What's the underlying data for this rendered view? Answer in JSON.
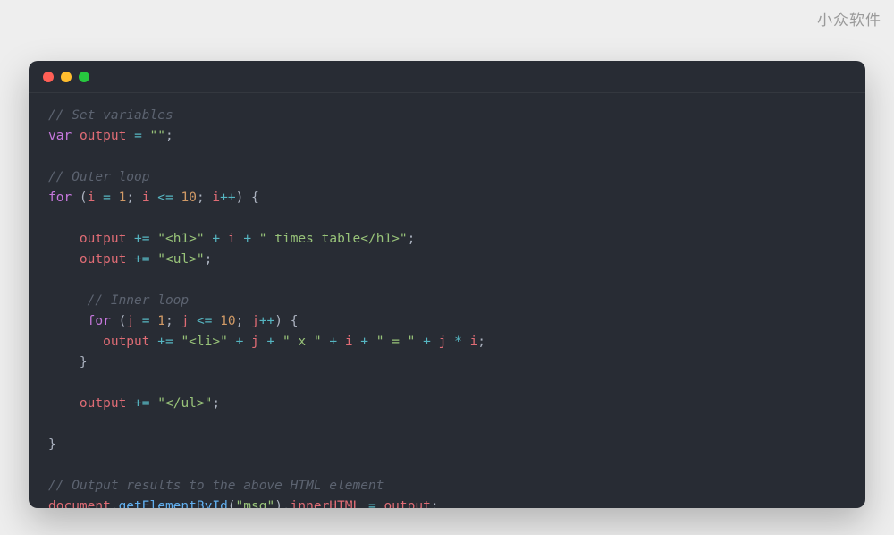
{
  "watermark": "小众软件",
  "code_tokens": [
    [
      {
        "c": "c-cm",
        "t": "// Set variables"
      }
    ],
    [
      {
        "c": "c-kw",
        "t": "var"
      },
      {
        "c": "c-pl",
        "t": " "
      },
      {
        "c": "c-id",
        "t": "output"
      },
      {
        "c": "c-pl",
        "t": " "
      },
      {
        "c": "c-op",
        "t": "="
      },
      {
        "c": "c-pl",
        "t": " "
      },
      {
        "c": "c-st",
        "t": "\"\""
      },
      {
        "c": "c-pl",
        "t": ";"
      }
    ],
    [],
    [
      {
        "c": "c-cm",
        "t": "// Outer loop"
      }
    ],
    [
      {
        "c": "c-kw",
        "t": "for"
      },
      {
        "c": "c-pl",
        "t": " ("
      },
      {
        "c": "c-id",
        "t": "i"
      },
      {
        "c": "c-pl",
        "t": " "
      },
      {
        "c": "c-op",
        "t": "="
      },
      {
        "c": "c-pl",
        "t": " "
      },
      {
        "c": "c-nm",
        "t": "1"
      },
      {
        "c": "c-pl",
        "t": "; "
      },
      {
        "c": "c-id",
        "t": "i"
      },
      {
        "c": "c-pl",
        "t": " "
      },
      {
        "c": "c-op",
        "t": "<="
      },
      {
        "c": "c-pl",
        "t": " "
      },
      {
        "c": "c-nm",
        "t": "10"
      },
      {
        "c": "c-pl",
        "t": "; "
      },
      {
        "c": "c-id",
        "t": "i"
      },
      {
        "c": "c-op",
        "t": "++"
      },
      {
        "c": "c-pl",
        "t": ") {"
      }
    ],
    [],
    [
      {
        "c": "c-pl",
        "t": "    "
      },
      {
        "c": "c-id",
        "t": "output"
      },
      {
        "c": "c-pl",
        "t": " "
      },
      {
        "c": "c-op",
        "t": "+="
      },
      {
        "c": "c-pl",
        "t": " "
      },
      {
        "c": "c-st",
        "t": "\"<h1>\""
      },
      {
        "c": "c-pl",
        "t": " "
      },
      {
        "c": "c-op",
        "t": "+"
      },
      {
        "c": "c-pl",
        "t": " "
      },
      {
        "c": "c-id",
        "t": "i"
      },
      {
        "c": "c-pl",
        "t": " "
      },
      {
        "c": "c-op",
        "t": "+"
      },
      {
        "c": "c-pl",
        "t": " "
      },
      {
        "c": "c-st",
        "t": "\" times table</h1>\""
      },
      {
        "c": "c-pl",
        "t": ";"
      }
    ],
    [
      {
        "c": "c-pl",
        "t": "    "
      },
      {
        "c": "c-id",
        "t": "output"
      },
      {
        "c": "c-pl",
        "t": " "
      },
      {
        "c": "c-op",
        "t": "+="
      },
      {
        "c": "c-pl",
        "t": " "
      },
      {
        "c": "c-st",
        "t": "\"<ul>\""
      },
      {
        "c": "c-pl",
        "t": ";"
      }
    ],
    [],
    [
      {
        "c": "c-pl",
        "t": "     "
      },
      {
        "c": "c-cm",
        "t": "// Inner loop"
      }
    ],
    [
      {
        "c": "c-pl",
        "t": "     "
      },
      {
        "c": "c-kw",
        "t": "for"
      },
      {
        "c": "c-pl",
        "t": " ("
      },
      {
        "c": "c-id",
        "t": "j"
      },
      {
        "c": "c-pl",
        "t": " "
      },
      {
        "c": "c-op",
        "t": "="
      },
      {
        "c": "c-pl",
        "t": " "
      },
      {
        "c": "c-nm",
        "t": "1"
      },
      {
        "c": "c-pl",
        "t": "; "
      },
      {
        "c": "c-id",
        "t": "j"
      },
      {
        "c": "c-pl",
        "t": " "
      },
      {
        "c": "c-op",
        "t": "<="
      },
      {
        "c": "c-pl",
        "t": " "
      },
      {
        "c": "c-nm",
        "t": "10"
      },
      {
        "c": "c-pl",
        "t": "; "
      },
      {
        "c": "c-id",
        "t": "j"
      },
      {
        "c": "c-op",
        "t": "++"
      },
      {
        "c": "c-pl",
        "t": ") {"
      }
    ],
    [
      {
        "c": "c-pl",
        "t": "       "
      },
      {
        "c": "c-id",
        "t": "output"
      },
      {
        "c": "c-pl",
        "t": " "
      },
      {
        "c": "c-op",
        "t": "+="
      },
      {
        "c": "c-pl",
        "t": " "
      },
      {
        "c": "c-st",
        "t": "\"<li>\""
      },
      {
        "c": "c-pl",
        "t": " "
      },
      {
        "c": "c-op",
        "t": "+"
      },
      {
        "c": "c-pl",
        "t": " "
      },
      {
        "c": "c-id",
        "t": "j"
      },
      {
        "c": "c-pl",
        "t": " "
      },
      {
        "c": "c-op",
        "t": "+"
      },
      {
        "c": "c-pl",
        "t": " "
      },
      {
        "c": "c-st",
        "t": "\" x \""
      },
      {
        "c": "c-pl",
        "t": " "
      },
      {
        "c": "c-op",
        "t": "+"
      },
      {
        "c": "c-pl",
        "t": " "
      },
      {
        "c": "c-id",
        "t": "i"
      },
      {
        "c": "c-pl",
        "t": " "
      },
      {
        "c": "c-op",
        "t": "+"
      },
      {
        "c": "c-pl",
        "t": " "
      },
      {
        "c": "c-st",
        "t": "\" = \""
      },
      {
        "c": "c-pl",
        "t": " "
      },
      {
        "c": "c-op",
        "t": "+"
      },
      {
        "c": "c-pl",
        "t": " "
      },
      {
        "c": "c-id",
        "t": "j"
      },
      {
        "c": "c-pl",
        "t": " "
      },
      {
        "c": "c-op",
        "t": "*"
      },
      {
        "c": "c-pl",
        "t": " "
      },
      {
        "c": "c-id",
        "t": "i"
      },
      {
        "c": "c-pl",
        "t": ";"
      }
    ],
    [
      {
        "c": "c-pl",
        "t": "    }"
      }
    ],
    [],
    [
      {
        "c": "c-pl",
        "t": "    "
      },
      {
        "c": "c-id",
        "t": "output"
      },
      {
        "c": "c-pl",
        "t": " "
      },
      {
        "c": "c-op",
        "t": "+="
      },
      {
        "c": "c-pl",
        "t": " "
      },
      {
        "c": "c-st",
        "t": "\"</ul>\""
      },
      {
        "c": "c-pl",
        "t": ";"
      }
    ],
    [],
    [
      {
        "c": "c-pl",
        "t": "}"
      }
    ],
    [],
    [
      {
        "c": "c-cm",
        "t": "// Output results to the above HTML element"
      }
    ],
    [
      {
        "c": "c-id",
        "t": "document"
      },
      {
        "c": "c-pl",
        "t": "."
      },
      {
        "c": "c-fn",
        "t": "getElementById"
      },
      {
        "c": "c-pl",
        "t": "("
      },
      {
        "c": "c-st",
        "t": "\"msg\""
      },
      {
        "c": "c-pl",
        "t": ")."
      },
      {
        "c": "c-id",
        "t": "innerHTML"
      },
      {
        "c": "c-pl",
        "t": " "
      },
      {
        "c": "c-op",
        "t": "="
      },
      {
        "c": "c-pl",
        "t": " "
      },
      {
        "c": "c-id",
        "t": "output"
      },
      {
        "c": "c-pl",
        "t": ";"
      }
    ]
  ]
}
